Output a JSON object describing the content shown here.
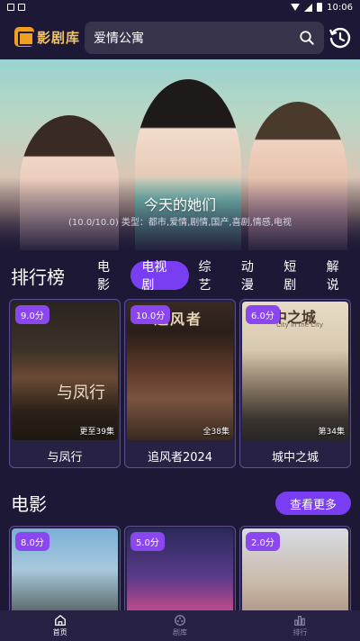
{
  "status": {
    "time": "10:06"
  },
  "app": {
    "logo_text": "影剧库"
  },
  "search": {
    "value": "爱情公寓"
  },
  "banner": {
    "title": "今天的她们",
    "subtitle": "(10.0/10.0) 类型：都市,爱情,剧情,国产,喜剧,情感,电视"
  },
  "ranking": {
    "title": "排行榜",
    "tabs": [
      {
        "label": "电影",
        "active": false
      },
      {
        "label": "电视剧",
        "active": true
      },
      {
        "label": "综艺",
        "active": false
      },
      {
        "label": "动漫",
        "active": false
      },
      {
        "label": "短剧",
        "active": false
      },
      {
        "label": "解说",
        "active": false
      }
    ],
    "items": [
      {
        "score": "9.0分",
        "episodes": "更至39集",
        "title": "与凤行",
        "poster_text": "与凤行"
      },
      {
        "score": "10.0分",
        "episodes": "全38集",
        "title": "追风者2024",
        "poster_text": "追风者"
      },
      {
        "score": "6.0分",
        "episodes": "第34集",
        "title": "城中之城",
        "poster_text": "城中之城",
        "poster_sub": "City in the City"
      }
    ]
  },
  "movies": {
    "title": "电影",
    "more_label": "查看更多",
    "items": [
      {
        "score": "8.0分"
      },
      {
        "score": "5.0分"
      },
      {
        "score": "2.0分"
      }
    ]
  },
  "bottom_nav": [
    {
      "label": "首页",
      "icon": "home-icon",
      "active": true
    },
    {
      "label": "剧库",
      "icon": "library-icon",
      "active": false
    },
    {
      "label": "排行",
      "icon": "ranking-icon",
      "active": false
    }
  ],
  "colors": {
    "accent": "#7a3ef2",
    "background": "#1c1836",
    "card_border": "#5b4f8e"
  }
}
